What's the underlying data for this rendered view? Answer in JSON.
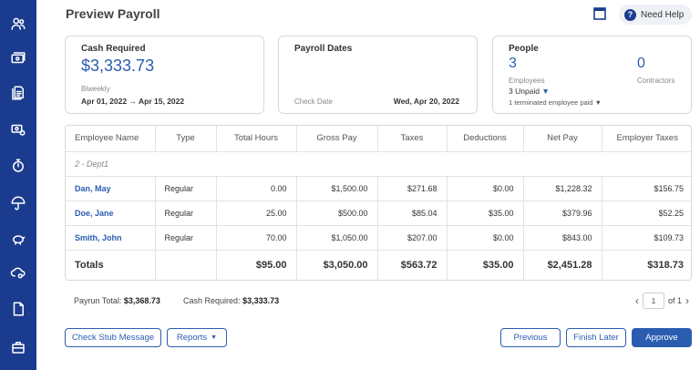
{
  "header": {
    "title": "Preview Payroll",
    "help_label": "Need Help",
    "help_glyph": "?"
  },
  "sidebar": {
    "items": [
      "people-icon",
      "money-icon",
      "documents-icon",
      "money-settings-icon",
      "timer-icon",
      "umbrella-icon",
      "piggy-bank-icon",
      "cloud-settings-icon",
      "file-icon",
      "briefcase-icon"
    ]
  },
  "cash_card": {
    "title": "Cash Required",
    "amount": "$3,333.73",
    "frequency": "Biweekly",
    "start": "Apr 01, 2022",
    "arrow": "→",
    "end": "Apr 15, 2022"
  },
  "dates_card": {
    "title": "Payroll Dates",
    "check_date_label": "Check Date",
    "check_date_value": "Wed, Apr 20, 2022"
  },
  "people_card": {
    "title": "People",
    "employees_count": "3",
    "employees_label": "Employees",
    "contractors_count": "0",
    "contractors_label": "Contractors",
    "unpaid": "3 Unpaid",
    "terminated": "1 terminated employee paid"
  },
  "table": {
    "headers": [
      "Employee Name",
      "Type",
      "Total Hours",
      "Gross Pay",
      "Taxes",
      "Deductions",
      "Net Pay",
      "Employer Taxes"
    ],
    "dept": "2 - Dept1",
    "rows": [
      [
        "Dan, May",
        "Regular",
        "0.00",
        "$1,500.00",
        "$271.68",
        "$0.00",
        "$1,228.32",
        "$156.75"
      ],
      [
        "Doe, Jane",
        "Regular",
        "25.00",
        "$500.00",
        "$85.04",
        "$35.00",
        "$379.96",
        "$52.25"
      ],
      [
        "Smith, John",
        "Regular",
        "70.00",
        "$1,050.00",
        "$207.00",
        "$0.00",
        "$843.00",
        "$109.73"
      ]
    ],
    "totals": [
      "Totals",
      "",
      "$95.00",
      "$3,050.00",
      "$563.72",
      "$35.00",
      "$2,451.28",
      "$318.73"
    ]
  },
  "footer": {
    "payrun_label": "Payrun Total:",
    "payrun_value": "$3,368.73",
    "cash_label": "Cash Required:",
    "cash_value": "$3,333.73",
    "page": "1",
    "of_label": "of 1"
  },
  "actions": {
    "check_stub": "Check Stub Message",
    "reports": "Reports",
    "previous": "Previous",
    "finish_later": "Finish Later",
    "approve": "Approve"
  },
  "colors": {
    "sidebar": "#1b3c8e",
    "accent": "#2a5db0"
  }
}
